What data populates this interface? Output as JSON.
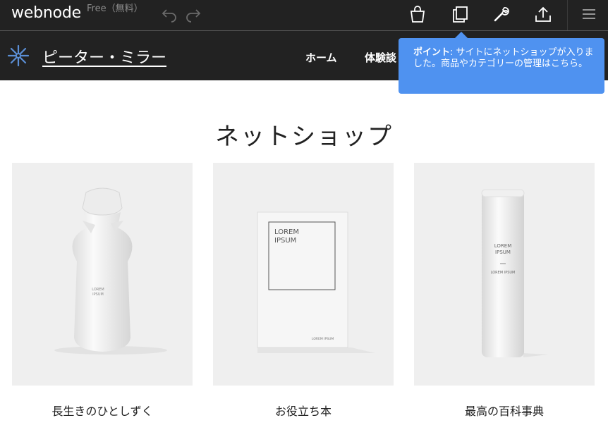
{
  "toolbar": {
    "logo": "webnode",
    "plan": "Free（無料）",
    "icons": [
      "undo-icon",
      "redo-icon",
      "shopping-bag-icon",
      "pages-icon",
      "wrench-icon",
      "upload-icon",
      "menu-icon"
    ]
  },
  "site": {
    "title": "ピーター・ミラー",
    "nav": [
      "ホーム",
      "体験談"
    ]
  },
  "tooltip": {
    "bold": "ポイント",
    "text": ": サイトにネットショップが入りました。商品やカテゴリーの管理はこちら。"
  },
  "shop": {
    "title": "ネットショップ",
    "products": [
      {
        "name": "長生きのひとしずく",
        "label": "LOREM IPSUM"
      },
      {
        "name": "お役立ち本",
        "label": "LOREM IPSUM"
      },
      {
        "name": "最高の百科事典",
        "label": "LOREM IPSUM"
      }
    ]
  },
  "colors": {
    "toolbar_bg": "#222222",
    "tooltip_bg": "#4f92f0",
    "logo_accent": "#5b8fd6",
    "card_bg": "#efefef"
  }
}
